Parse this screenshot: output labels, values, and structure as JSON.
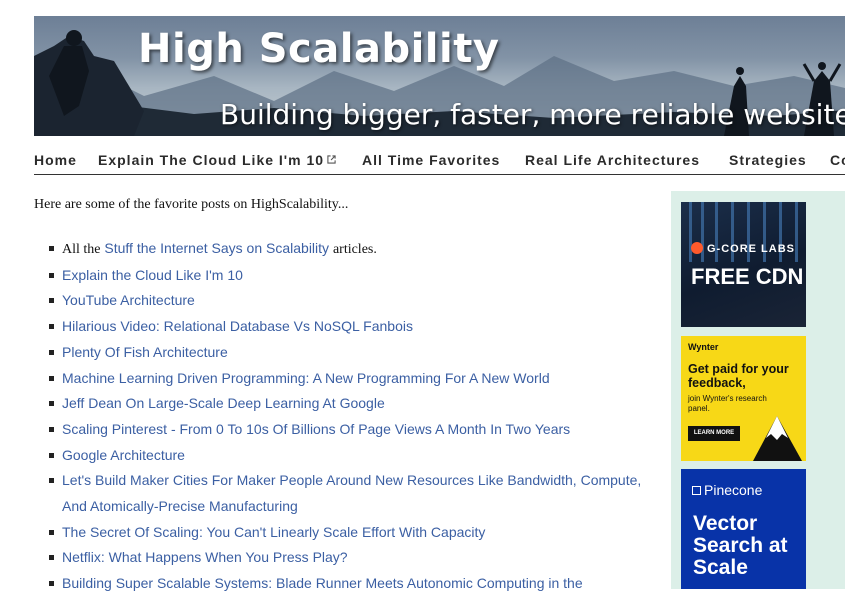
{
  "banner": {
    "title": "High Scalability",
    "tagline": "Building bigger, faster, more reliable websites."
  },
  "nav": [
    {
      "label": "Home",
      "external": false
    },
    {
      "label": "Explain The Cloud Like I'm 10",
      "external": true
    },
    {
      "label": "All Time Favorites",
      "external": false
    },
    {
      "label": "Real Life Architectures",
      "external": false
    },
    {
      "label": "Strategies",
      "external": false
    },
    {
      "label": "Co",
      "external": false
    }
  ],
  "main": {
    "intro": "Here are some of the favorite posts on HighScalability...",
    "first_item": {
      "prefix": "All the",
      "link": "Stuff the Internet Says on Scalability",
      "suffix": "articles."
    },
    "links": [
      "Explain the Cloud Like I'm 10",
      "YouTube Architecture",
      "Hilarious Video: Relational Database Vs NoSQL Fanbois",
      "Plenty Of Fish Architecture",
      "Machine Learning Driven Programming: A New Programming For A New World",
      "Jeff Dean On Large-Scale Deep Learning At Google",
      "Scaling Pinterest - From 0 To 10s Of Billions Of Page Views A Month In Two Years",
      "Google Architecture",
      "Let's Build Maker Cities For Maker People Around New Resources Like Bandwidth, Compute, And Atomically-Precise Manufacturing",
      "The Secret Of Scaling: You Can't Linearly Scale Effort With Capacity",
      "Netflix: What Happens When You Press Play?",
      "Building Super Scalable Systems: Blade Runner Meets Autonomic Computing in the"
    ]
  },
  "sidebar": {
    "ads": [
      {
        "brand": "G-CORE LABS",
        "headline": "FREE CDN",
        "icon": "g-logo-icon"
      },
      {
        "brand": "Wynter",
        "headline": "Get paid for your feedback,",
        "subtext": "join Wynter's research panel.",
        "button": "LEARN MORE",
        "icon": "mountain-icon"
      },
      {
        "brand": "Pinecone",
        "headline": "Vector Search at Scale",
        "icon": "pinecone-cube-icon"
      }
    ]
  },
  "colors": {
    "link": "#3b5fa3",
    "sidebar_bg": "#dcefe8",
    "pinecone_bg": "#0833a8",
    "wynter_bg": "#f7d817"
  }
}
